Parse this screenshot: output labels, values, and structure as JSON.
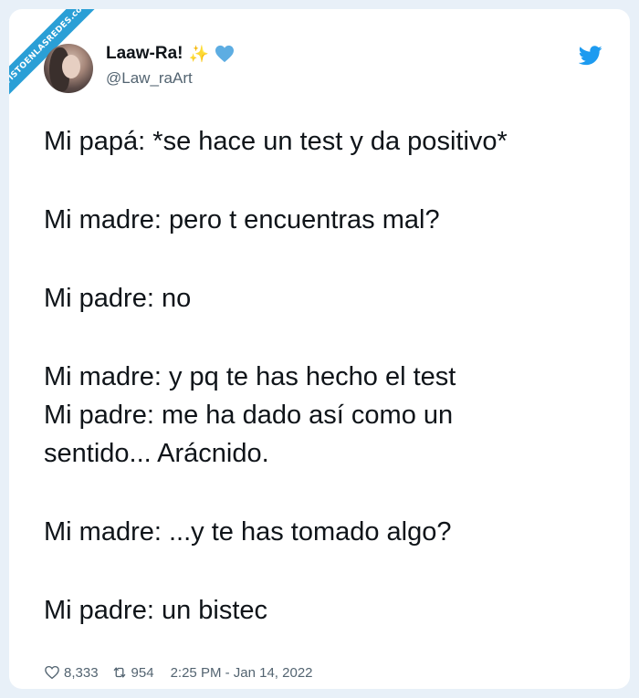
{
  "watermark": {
    "text": "VISTOENLASREDES.com"
  },
  "author": {
    "display_name": "Laaw-Ra!",
    "emoji_sparkles": "✨",
    "handle": "@Law_raArt"
  },
  "tweet": {
    "lines": [
      "Mi papá: *se hace un test y da positivo*",
      "",
      "Mi madre: pero t encuentras mal?",
      "",
      "Mi padre: no",
      "",
      "Mi madre: y pq te has hecho el test",
      "Mi padre: me ha dado así como un",
      "sentido... Arácnido.",
      "",
      "Mi madre: ...y te has tomado algo?",
      "",
      "Mi padre: un bistec"
    ]
  },
  "stats": {
    "likes": "8,333",
    "retweets": "954",
    "timestamp": "2:25 PM - Jan 14, 2022"
  },
  "colors": {
    "twitter_blue": "#1d9bf0",
    "text": "#0f1419",
    "muted": "#536471",
    "ribbon": "#2a9fd6"
  },
  "icons": {
    "logo": "twitter-bird-icon",
    "heart": "heart-icon",
    "retweet": "retweet-icon",
    "badge_heart": "blue-heart-icon"
  }
}
